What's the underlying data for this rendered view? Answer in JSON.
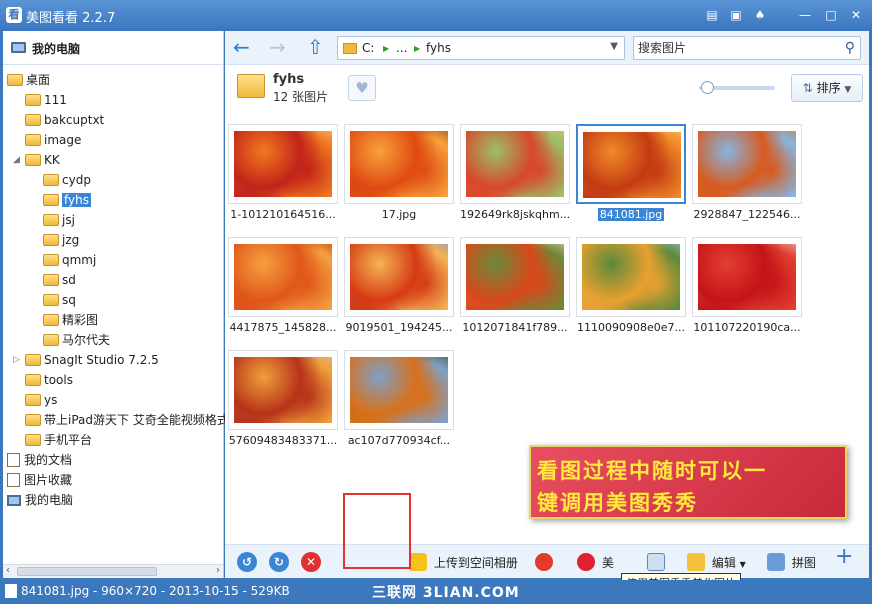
{
  "window": {
    "title": "美图看看 2.2.7",
    "logo": "看"
  },
  "sidebar": {
    "header": "我的电脑",
    "tree": [
      {
        "label": "桌面",
        "icon": "folder-icon",
        "level": 0
      },
      {
        "label": "111",
        "icon": "folder-icon",
        "level": 1
      },
      {
        "label": "bakcuptxt",
        "icon": "folder-icon",
        "level": 1
      },
      {
        "label": "image",
        "icon": "folder-icon",
        "level": 1
      },
      {
        "label": "KK",
        "icon": "folder-icon",
        "level": 1,
        "expanded": true
      },
      {
        "label": "cydp",
        "icon": "folder-icon",
        "level": 2
      },
      {
        "label": "fyhs",
        "icon": "folder-icon",
        "level": 2,
        "selected": true
      },
      {
        "label": "jsj",
        "icon": "folder-icon",
        "level": 2
      },
      {
        "label": "jzg",
        "icon": "folder-icon",
        "level": 2
      },
      {
        "label": "qmmj",
        "icon": "folder-icon",
        "level": 2
      },
      {
        "label": "sd",
        "icon": "folder-icon",
        "level": 2
      },
      {
        "label": "sq",
        "icon": "folder-icon",
        "level": 2
      },
      {
        "label": "精彩图",
        "icon": "folder-icon",
        "level": 2
      },
      {
        "label": "马尔代夫",
        "icon": "folder-icon",
        "level": 2
      },
      {
        "label": "SnagIt Studio 7.2.5",
        "icon": "folder-icon",
        "level": 1,
        "collapsed": true
      },
      {
        "label": "tools",
        "icon": "folder-icon",
        "level": 1
      },
      {
        "label": "ys",
        "icon": "folder-icon",
        "level": 1
      },
      {
        "label": "带上iPad游天下 艾奇全能视频格式",
        "icon": "folder-icon",
        "level": 1
      },
      {
        "label": "手机平台",
        "icon": "folder-icon",
        "level": 1
      },
      {
        "label": "我的文档",
        "icon": "document-icon",
        "level": 0
      },
      {
        "label": "图片收藏",
        "icon": "document-icon",
        "level": 0
      },
      {
        "label": "我的电脑",
        "icon": "computer-icon",
        "level": 0
      }
    ]
  },
  "navbar": {
    "address": {
      "drive": "C:",
      "ellipsis": "...",
      "folder": "fyhs"
    },
    "search": {
      "placeholder": "搜索图片"
    }
  },
  "folder": {
    "name": "fyhs",
    "count": "12 张图片"
  },
  "sort": {
    "label": "排序",
    "icon": "sort-icon"
  },
  "thumbnails": [
    {
      "name": "1-101210164516...",
      "palette": [
        "#c2231a",
        "#f07a1e",
        "#ffd3a0"
      ],
      "selected": false
    },
    {
      "name": "17.jpg",
      "palette": [
        "#e04a12",
        "#f7a23a",
        "#6d3414"
      ],
      "selected": false
    },
    {
      "name": "192649rk8jskqhm...",
      "palette": [
        "#d9462a",
        "#9bbf6a",
        "#f2c46a"
      ],
      "selected": false
    },
    {
      "name": "841081.jpg",
      "palette": [
        "#c33a12",
        "#f08a28",
        "#f5d27a"
      ],
      "selected": true
    },
    {
      "name": "2928847_122546...",
      "palette": [
        "#d85a20",
        "#86b5e0",
        "#c77a2a"
      ],
      "selected": false
    },
    {
      "name": "4417875_145828...",
      "palette": [
        "#e0561a",
        "#f5a040",
        "#b62a12"
      ],
      "selected": false
    },
    {
      "name": "9019501_194245...",
      "palette": [
        "#d63a14",
        "#f3b455",
        "#7a9ac8"
      ],
      "selected": false
    },
    {
      "name": "1012071841f789...",
      "palette": [
        "#d8481a",
        "#6b8a3a",
        "#ede0c0"
      ],
      "selected": false
    },
    {
      "name": "1110090908e0e7...",
      "palette": [
        "#e8a030",
        "#5b8a3a",
        "#aac9e8"
      ],
      "selected": false
    },
    {
      "name": "101107220190ca...",
      "palette": [
        "#c4141a",
        "#e24030",
        "#f4e6d8"
      ],
      "selected": false
    },
    {
      "name": "57609483483371...",
      "palette": [
        "#b6321a",
        "#f0a03a",
        "#d8c3a8"
      ],
      "selected": false
    },
    {
      "name": "ac107d770934cf...",
      "palette": [
        "#d8701a",
        "#7ea0c8",
        "#2e4a1a"
      ],
      "selected": false
    }
  ],
  "banner": {
    "line1": "看图过程中随时可以一",
    "line2": "键调用美图秀秀"
  },
  "bottombar": {
    "upload_label": "上传到空间相册",
    "meitu_label": "美",
    "meitu_tooltip": "使用美图秀秀美化图片",
    "edit_label": "编辑",
    "collage_label": "拼图",
    "add_symbol": "+"
  },
  "statusbar": {
    "file": "841081.jpg - 960×720 - 2013-10-15 - 529KB",
    "watermark": "三联网 3LIAN.COM"
  },
  "colors": {
    "accent": "#3a86d5",
    "titlebar": "#3a76bf",
    "banner": "#d63a48",
    "banner_text": "#ffe93c"
  }
}
